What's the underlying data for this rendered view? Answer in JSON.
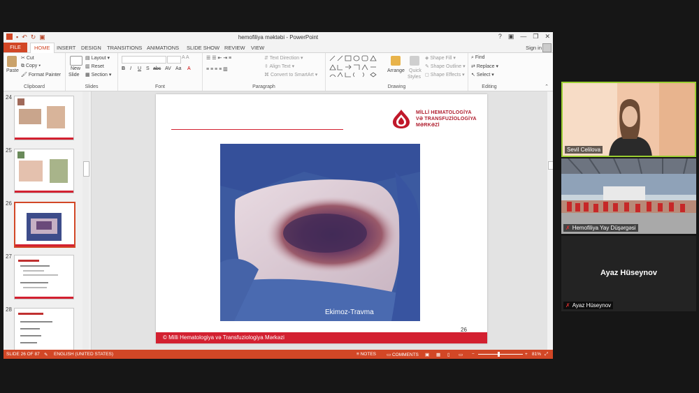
{
  "app": {
    "title": "hemofiliya məktəbi - PowerPoint",
    "sign_in": "Sign in",
    "window_controls": [
      "?",
      "▣",
      "—",
      "❐",
      "✕"
    ]
  },
  "tabs": [
    "FILE",
    "HOME",
    "INSERT",
    "DESIGN",
    "TRANSITIONS",
    "ANIMATIONS",
    "SLIDE SHOW",
    "REVIEW",
    "VIEW"
  ],
  "active_tab": "HOME",
  "ribbon": {
    "clipboard": {
      "label": "Clipboard",
      "paste": "Paste",
      "cut": "Cut",
      "copy": "Copy",
      "format_painter": "Format Painter"
    },
    "slides": {
      "label": "Slides",
      "new_slide_1": "New",
      "new_slide_2": "Slide",
      "layout": "Layout",
      "reset": "Reset",
      "section": "Section"
    },
    "font": {
      "label": "Font",
      "buttons": [
        "B",
        "I",
        "U",
        "S",
        "abc",
        "AV",
        "Aa",
        "A"
      ]
    },
    "paragraph": {
      "label": "Paragraph",
      "text_direction": "Text Direction",
      "align_text": "Align Text",
      "convert": "Convert to SmartArt"
    },
    "drawing": {
      "label": "Drawing",
      "arrange": "Arrange",
      "quick_styles_1": "Quick",
      "quick_styles_2": "Styles",
      "shape_fill": "Shape Fill",
      "shape_outline": "Shape Outline",
      "shape_effects": "Shape Effects"
    },
    "editing": {
      "label": "Editing",
      "find": "Find",
      "replace": "Replace",
      "select": "Select"
    }
  },
  "thumbnails": [
    {
      "num": "24"
    },
    {
      "num": "25"
    },
    {
      "num": "26"
    },
    {
      "num": "27"
    },
    {
      "num": "28"
    }
  ],
  "slide": {
    "logo_line1": "MİLLİ HEMATOLOGİYA",
    "logo_line2": "VƏ TRANSFUZİOLOGİYA",
    "logo_line3": "MƏRKƏZİ",
    "caption": "Ekimoz-Travma",
    "number": "26",
    "footer": "© Milli Hematologiya və Transfuziologiya Mərkəzi"
  },
  "status": {
    "slide": "SLIDE 26 OF 87",
    "language": "ENGLISH (UNITED STATES)",
    "notes": "NOTES",
    "comments": "COMMENTS",
    "zoom": "81%"
  },
  "participants": [
    {
      "name": "Sevil Celilova"
    },
    {
      "name": "Hemofiliya Yay Düşərgəsi"
    },
    {
      "name": "Ayaz Hüseynov",
      "display": "Ayaz Hüseynov"
    }
  ],
  "colors": {
    "accent": "#d24726",
    "brand_red": "#d32030",
    "active_speaker": "#9acd32"
  }
}
